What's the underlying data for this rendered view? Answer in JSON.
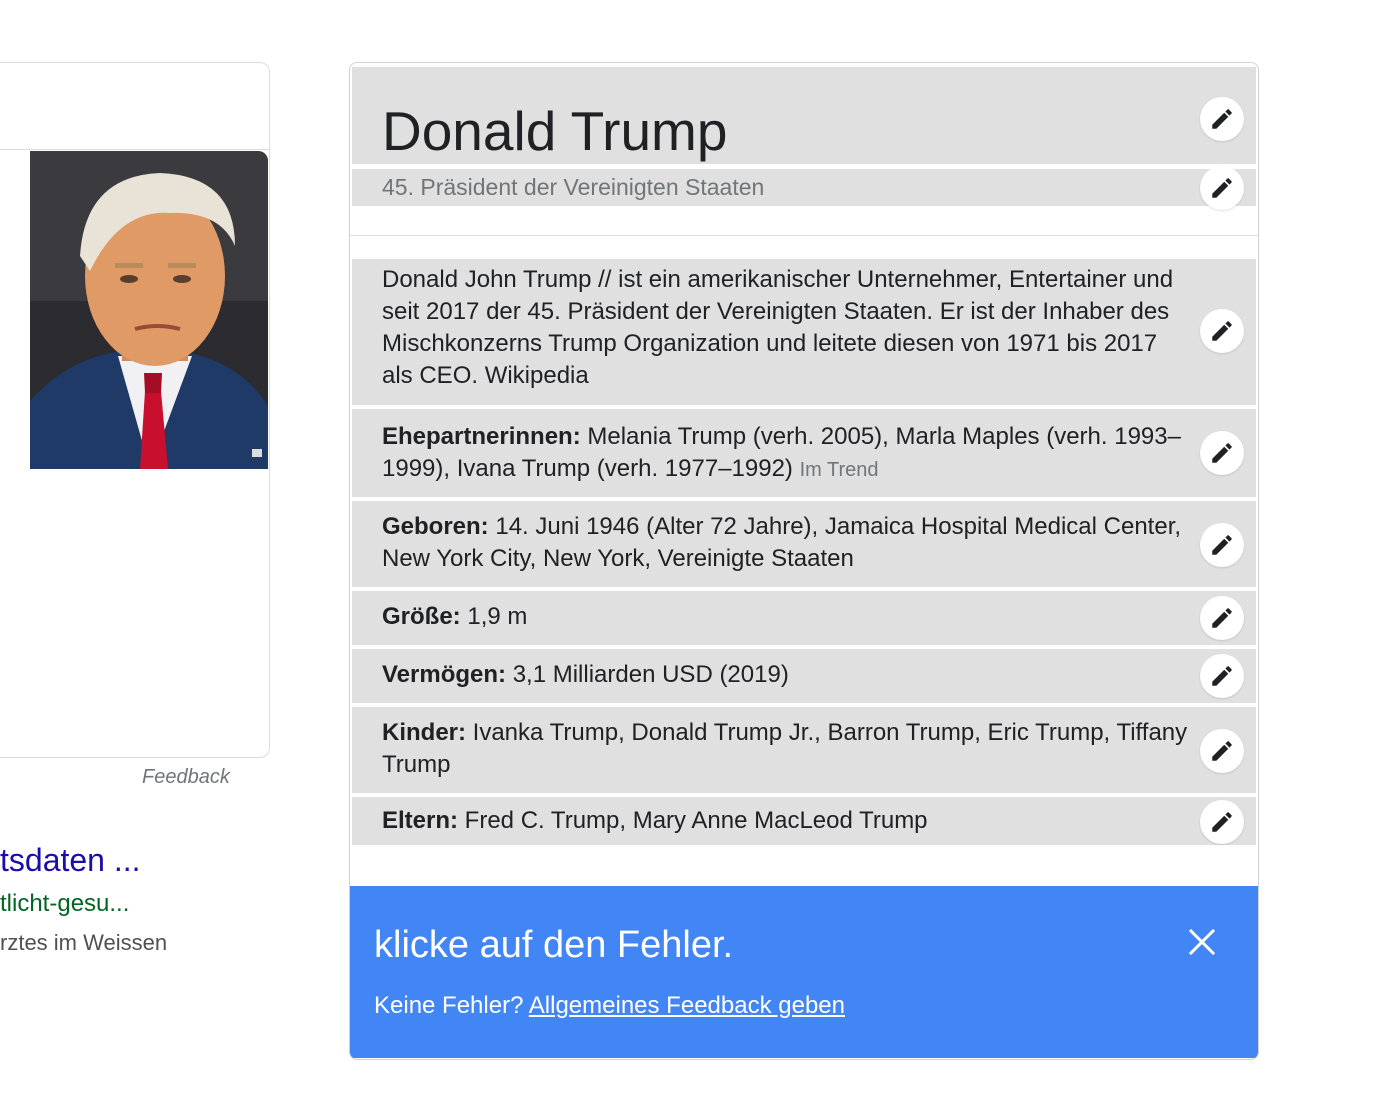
{
  "left_card": {
    "feedback_label": "Feedback",
    "photo_alt": "Donald Trump"
  },
  "result": {
    "title": "tsdaten ...",
    "url": "tlicht-gesu...",
    "snippet": "rztes im Weissen"
  },
  "panel": {
    "title": "Donald Trump",
    "subtitle": "45. Präsident der Vereinigten Staaten",
    "description": "Donald John Trump // ist ein amerikanischer Unternehmer, Entertainer und seit 2017 der 45. Präsident der Vereinigten Staaten. Er ist der Inhaber des Mischkonzerns Trump Organization und leitete diesen von 1971 bis 2017 als CEO. Wikipedia",
    "facts": [
      {
        "label": "Ehepartnerinnen:",
        "value": " Melania Trump (verh. 2005), Marla Maples (verh. 1993–1999), Ivana Trump (verh. 1977–1992) ",
        "extra": "Im Trend"
      },
      {
        "label": "Geboren:",
        "value": " 14. Juni 1946 (Alter 72 Jahre), Jamaica Hospital Medical Center, New York City, New York, Vereinigte Staaten"
      },
      {
        "label": "Größe:",
        "value": " 1,9 m"
      },
      {
        "label": "Vermögen:",
        "value": " 3,1 Milliarden USD (2019)"
      },
      {
        "label": "Kinder:",
        "value": " Ivanka Trump, Donald Trump Jr., Barron Trump, Eric Trump, Tiffany Trump"
      },
      {
        "label": "Eltern:",
        "value": " Fred C. Trump, Mary Anne MacLeod Trump"
      }
    ]
  },
  "banner": {
    "title": "klicke auf den Fehler.",
    "prompt": "Keine Fehler? ",
    "link": "Allgemeines Feedback geben"
  },
  "icons": {
    "edit": "pencil-icon",
    "close": "close-icon"
  },
  "colors": {
    "banner": "#4285f4",
    "row_highlight": "#e0e0e0",
    "link": "#1a0dab",
    "url": "#006621"
  }
}
